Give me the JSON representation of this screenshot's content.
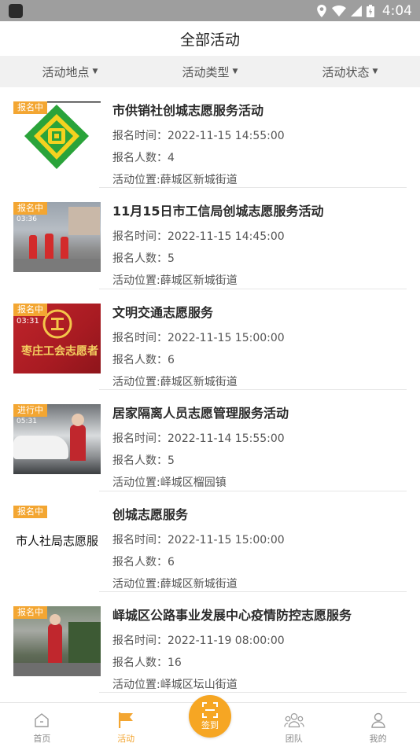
{
  "status_bar": {
    "time": "4:04"
  },
  "header": {
    "title": "全部活动"
  },
  "filters": [
    {
      "label": "活动地点"
    },
    {
      "label": "活动类型"
    },
    {
      "label": "活动状态"
    }
  ],
  "activities": [
    {
      "badge": "报名中",
      "title": "市供销社创城志愿服务活动",
      "time_label": "报名时间：",
      "time": "2022-11-15 14:55:00",
      "count_label": "报名人数：",
      "count": "4",
      "location_label": "活动位置:",
      "location": "薛城区新城街道",
      "thumb": "logo"
    },
    {
      "badge": "报名中",
      "title": "11月15日市工信局创城志愿服务活动",
      "time_label": "报名时间：",
      "time": "2022-11-15 14:45:00",
      "count_label": "报名人数：",
      "count": "5",
      "location_label": "活动位置:",
      "location": "薛城区新城街道",
      "thumb": "photo",
      "thumb_time": "03:36"
    },
    {
      "badge": "报名中",
      "title": "文明交通志愿服务",
      "time_label": "报名时间：",
      "time": "2022-11-15 15:00:00",
      "count_label": "报名人数：",
      "count": "6",
      "location_label": "活动位置:",
      "location": "薛城区新城街道",
      "thumb": "banner",
      "thumb_time": "03:31",
      "banner_text": "枣庄工会志愿者"
    },
    {
      "badge": "进行中",
      "title": "居家隔离人员志愿管理服务活动",
      "time_label": "报名时间：",
      "time": "2022-11-14 15:55:00",
      "count_label": "报名人数：",
      "count": "5",
      "location_label": "活动位置:",
      "location": "峄城区榴园镇",
      "thumb": "photo",
      "thumb_time": "05:31"
    },
    {
      "badge": "报名中",
      "title": "创城志愿服务",
      "time_label": "报名时间：",
      "time": "2022-11-15 15:00:00",
      "count_label": "报名人数：",
      "count": "6",
      "location_label": "活动位置:",
      "location": "薛城区新城街道",
      "thumb": "text",
      "thumb_text": "市人社局志愿服"
    },
    {
      "badge": "报名中",
      "title": "峄城区公路事业发展中心疫情防控志愿服务",
      "time_label": "报名时间：",
      "time": "2022-11-19 08:00:00",
      "count_label": "报名人数：",
      "count": "16",
      "location_label": "活动位置:",
      "location": "峄城区坛山街道",
      "thumb": "photo"
    }
  ],
  "tabbar": {
    "home": "首页",
    "activity": "活动",
    "signin": "签到",
    "team": "团队",
    "mine": "我的"
  },
  "colors": {
    "accent": "#f3a632",
    "status_bar": "#9e9e9e",
    "filter_bg": "#f1f1f1",
    "logo_green": "#2aa33a",
    "logo_yellow": "#f4d21f"
  }
}
